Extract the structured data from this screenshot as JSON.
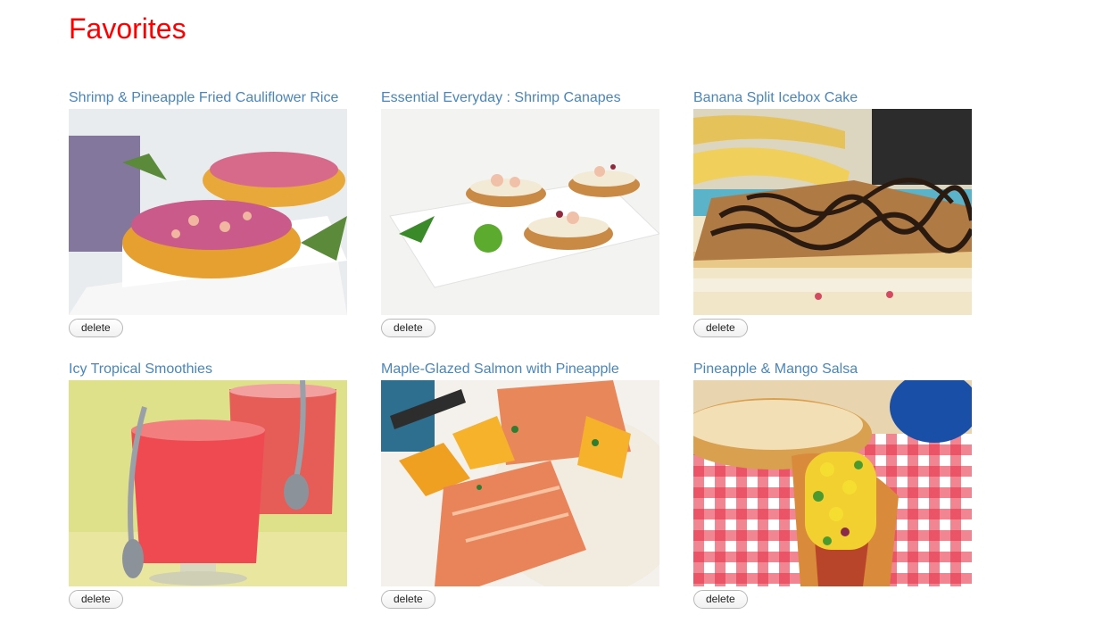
{
  "page": {
    "title": "Favorites"
  },
  "recipes": [
    {
      "title": "Shrimp & Pineapple Fried Cauliflower Rice",
      "delete_label": "delete",
      "image": "shrimp-pineapple-boat-photo"
    },
    {
      "title": "Essential Everyday : Shrimp Canapes",
      "delete_label": "delete",
      "image": "shrimp-canapes-photo"
    },
    {
      "title": "Banana Split Icebox Cake",
      "delete_label": "delete",
      "image": "banana-split-cake-photo"
    },
    {
      "title": "Icy Tropical Smoothies",
      "delete_label": "delete",
      "image": "smoothies-photo"
    },
    {
      "title": "Maple-Glazed Salmon with Pineapple",
      "delete_label": "delete",
      "image": "salmon-pineapple-photo"
    },
    {
      "title": "Pineapple & Mango Salsa",
      "delete_label": "delete",
      "image": "mango-salsa-hotdog-photo"
    }
  ],
  "colors": {
    "title": "#ff0000",
    "link": "#4a86b8"
  }
}
